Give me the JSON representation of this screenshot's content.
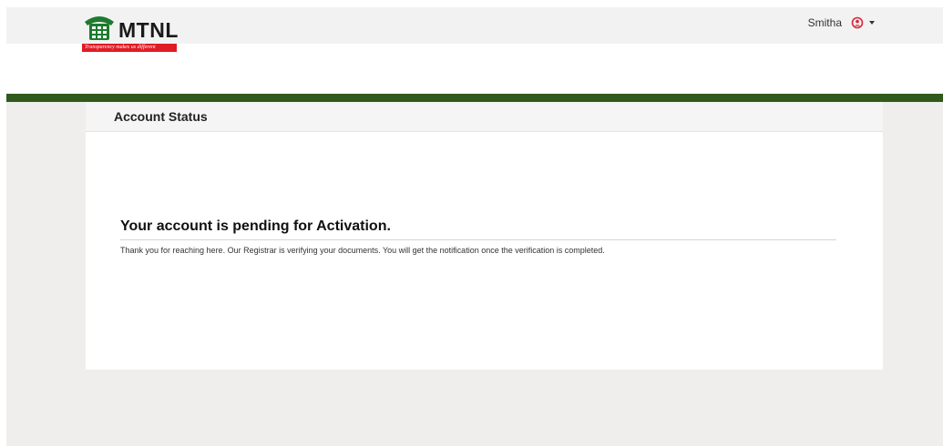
{
  "header": {
    "brand": "MTNL",
    "tagline": "Transparency makes us different",
    "user": {
      "name": "Smitha",
      "icon": "user-circle-icon",
      "menu_icon": "caret-down-icon"
    }
  },
  "colors": {
    "accent_green": "#2f5a1c",
    "brand_red": "#e01b24"
  },
  "main": {
    "panel_title": "Account Status",
    "status_heading": "Your account is pending for Activation.",
    "status_message": "Thank you for reaching here. Our Registrar is verifying your documents. You will get the notification once the verification is completed."
  }
}
